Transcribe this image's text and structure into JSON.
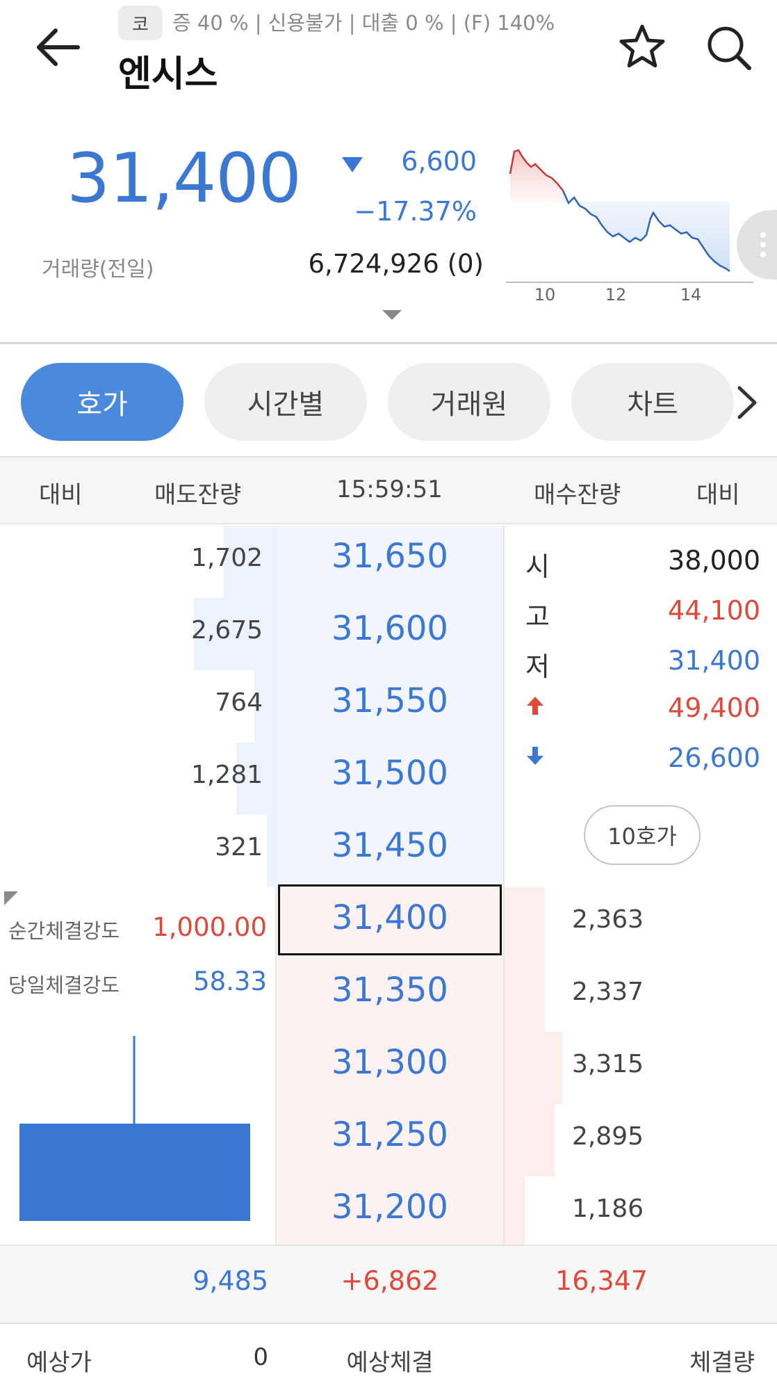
{
  "header": {
    "market_badge": "코",
    "stock_meta": "증 40 % | 신용불가 | 대출 0 % | (F) 140%",
    "stock_name": "엔시스"
  },
  "quote": {
    "price": "31,400",
    "change_value": "6,600",
    "change_pct": "−17.37%",
    "volume_label": "거래량(전일)",
    "volume_value": "6,724,926 (0)",
    "direction": "down",
    "color_down": "#3a78d4",
    "color_up": "#e0483a"
  },
  "mini_chart": {
    "x_ticks": [
      "10",
      "12",
      "14"
    ]
  },
  "tabs": [
    "호가",
    "시간별",
    "거래원",
    "차트"
  ],
  "orderbook": {
    "headers": {
      "ask_diff": "대비",
      "ask_qty": "매도잔량",
      "time": "15:59:51",
      "bid_qty": "매수잔량",
      "bid_diff": "대비"
    },
    "asks": [
      {
        "qty": "1,702",
        "price": "31,650",
        "share": 0.21
      },
      {
        "qty": "2,675",
        "price": "31,600",
        "share": 0.33
      },
      {
        "qty": "764",
        "price": "31,550",
        "share": 0.09
      },
      {
        "qty": "1,281",
        "price": "31,500",
        "share": 0.16
      },
      {
        "qty": "321",
        "price": "31,450",
        "share": 0.04
      }
    ],
    "bids": [
      {
        "qty": "2,363",
        "price": "31,400",
        "share": 0.16
      },
      {
        "qty": "2,337",
        "price": "31,350",
        "share": 0.16
      },
      {
        "qty": "3,315",
        "price": "31,300",
        "share": 0.23
      },
      {
        "qty": "2,895",
        "price": "31,250",
        "share": 0.2
      },
      {
        "qty": "1,186",
        "price": "31,200",
        "share": 0.08
      }
    ],
    "info": [
      {
        "label": "시",
        "value": "38,000",
        "color": "#222222"
      },
      {
        "label": "고",
        "value": "44,100",
        "color": "#e0483a"
      },
      {
        "label": "저",
        "value": "31,400",
        "color": "#3a78d4"
      },
      {
        "label": "",
        "icon": "up-arrow-icon",
        "value": "49,400",
        "color": "#e0483a"
      },
      {
        "label": "",
        "icon": "down-arrow-icon",
        "value": "26,600",
        "color": "#3a78d4"
      }
    ],
    "hoga10_label": "10호가",
    "strength": {
      "instant_label": "순간체결강도",
      "instant_value": "1,000.00",
      "day_label": "당일체결강도",
      "day_value": "58.33"
    }
  },
  "totals": {
    "ask_total": "9,485",
    "diff": "+6,862",
    "bid_total": "16,347"
  },
  "bottom": {
    "expected_price_label": "예상가",
    "expected_price_value": "0",
    "expected_fill_label": "예상체결",
    "fill_qty_label": "체결량"
  }
}
